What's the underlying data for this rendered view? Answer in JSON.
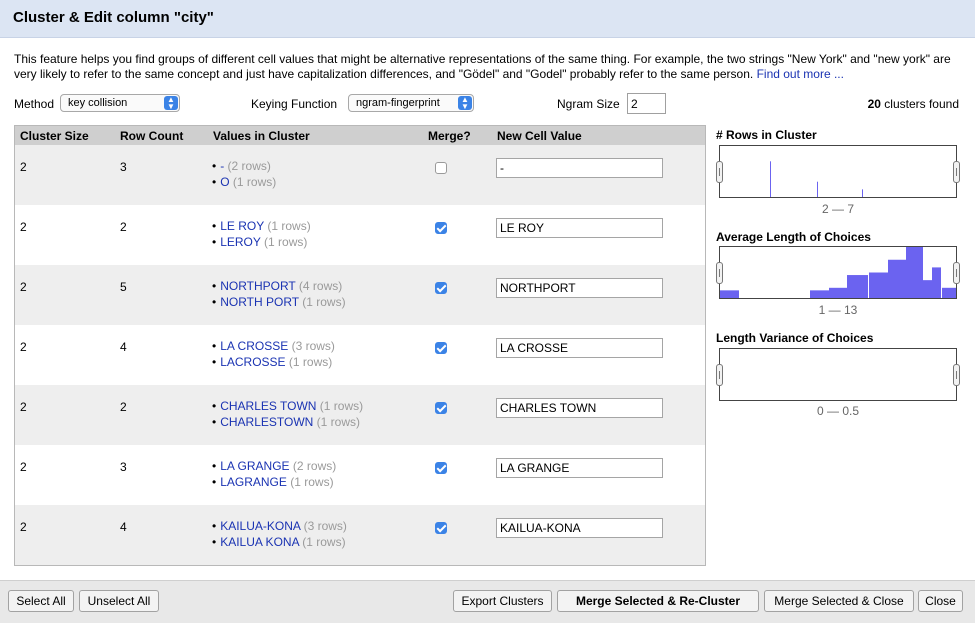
{
  "dialog": {
    "title": "Cluster & Edit column \"city\""
  },
  "intro": {
    "text": "This feature helps you find groups of different cell values that might be alternative representations of the same thing. For example, the two strings \"New York\" and \"new york\" are very likely to refer to the same concept and just have capitalization differences, and \"Gödel\" and \"Godel\" probably refer to the same person.",
    "link": "Find out more ..."
  },
  "controls": {
    "method_label": "Method",
    "method_value": "key collision",
    "keying_label": "Keying Function",
    "keying_value": "ngram-fingerprint",
    "ngram_label": "Ngram Size",
    "ngram_value": "2",
    "clusters_count": "20",
    "clusters_suffix": "clusters found"
  },
  "table": {
    "headers": [
      "Cluster Size",
      "Row Count",
      "Values in Cluster",
      "Merge?",
      "New Cell Value"
    ],
    "rows": [
      {
        "size": "2",
        "count": "3",
        "values": [
          {
            "name": "-",
            "rows": "(2 rows)"
          },
          {
            "name": "O",
            "rows": "(1 rows)"
          }
        ],
        "merge": false,
        "new_value": "-"
      },
      {
        "size": "2",
        "count": "2",
        "values": [
          {
            "name": "LE ROY",
            "rows": "(1 rows)"
          },
          {
            "name": "LEROY",
            "rows": "(1 rows)"
          }
        ],
        "merge": true,
        "new_value": "LE ROY"
      },
      {
        "size": "2",
        "count": "5",
        "values": [
          {
            "name": "NORTHPORT",
            "rows": "(4 rows)"
          },
          {
            "name": "NORTH PORT",
            "rows": "(1 rows)"
          }
        ],
        "merge": true,
        "new_value": "NORTHPORT"
      },
      {
        "size": "2",
        "count": "4",
        "values": [
          {
            "name": "LA CROSSE",
            "rows": "(3 rows)"
          },
          {
            "name": "LACROSSE",
            "rows": "(1 rows)"
          }
        ],
        "merge": true,
        "new_value": "LA CROSSE"
      },
      {
        "size": "2",
        "count": "2",
        "values": [
          {
            "name": "CHARLES TOWN",
            "rows": "(1 rows)"
          },
          {
            "name": "CHARLESTOWN",
            "rows": "(1 rows)"
          }
        ],
        "merge": true,
        "new_value": "CHARLES TOWN"
      },
      {
        "size": "2",
        "count": "3",
        "values": [
          {
            "name": "LA GRANGE",
            "rows": "(2 rows)"
          },
          {
            "name": "LAGRANGE",
            "rows": "(1 rows)"
          }
        ],
        "merge": true,
        "new_value": "LA GRANGE"
      },
      {
        "size": "2",
        "count": "4",
        "values": [
          {
            "name": "KAILUA-KONA",
            "rows": "(3 rows)"
          },
          {
            "name": "KAILUA KONA",
            "rows": "(1 rows)"
          }
        ],
        "merge": true,
        "new_value": "KAILUA-KONA"
      }
    ]
  },
  "facets": [
    {
      "title": "# Rows in Cluster",
      "range": "2 — 7",
      "bar_heights": [
        0.7,
        0.3,
        0.15
      ]
    },
    {
      "title": "Average Length of Choices",
      "range": "1 — 13",
      "bar_heights": [
        0.15,
        0.15,
        0.2,
        0.45,
        0.5,
        0.75,
        1.0,
        0.35,
        0.6,
        0.2
      ]
    },
    {
      "title": "Length Variance of Choices",
      "range": "0 — 0.5",
      "bar_heights": []
    }
  ],
  "footer": {
    "select_all": "Select All",
    "unselect_all": "Unselect All",
    "export": "Export Clusters",
    "merge_recluster": "Merge Selected & Re-Cluster",
    "merge_close": "Merge Selected & Close",
    "close": "Close"
  },
  "colors": {
    "title_bg": "#dce5f3",
    "link": "#1a33b2",
    "accent": "#3b83e6",
    "histogram": "#6b63f0"
  },
  "icons": [
    "select-arrows-icon",
    "checkbox-icon",
    "slider-handle-icon"
  ]
}
